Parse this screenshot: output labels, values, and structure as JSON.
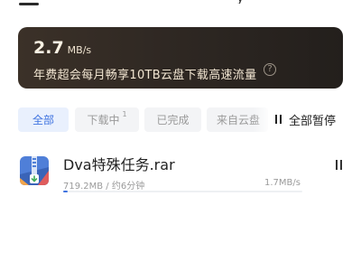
{
  "header": {
    "partial_glyph": "y"
  },
  "promo": {
    "speed_value": "2.7",
    "speed_unit": "MB/s",
    "text": "年费超会每月畅享10TB云盘下载高速流量",
    "help_icon_char": "?"
  },
  "tabs": [
    {
      "label": "全部",
      "active": true
    },
    {
      "label": "下载中",
      "badge": "1"
    },
    {
      "label": "已完成"
    },
    {
      "label": "来自云盘"
    }
  ],
  "pause_all_label": "全部暂停",
  "task": {
    "name": "Dva特殊任务.rar",
    "progress_text": "719.2MB / 约6分钟",
    "speed": "1.7MB/s",
    "progress": 0.02,
    "icon": "rar-archive-icon"
  },
  "colors": {
    "accent": "#3f73e0",
    "banner_bg": "#2f2823",
    "banner_text": "#f4ead8",
    "archive_icon": "#4f7fd8"
  }
}
